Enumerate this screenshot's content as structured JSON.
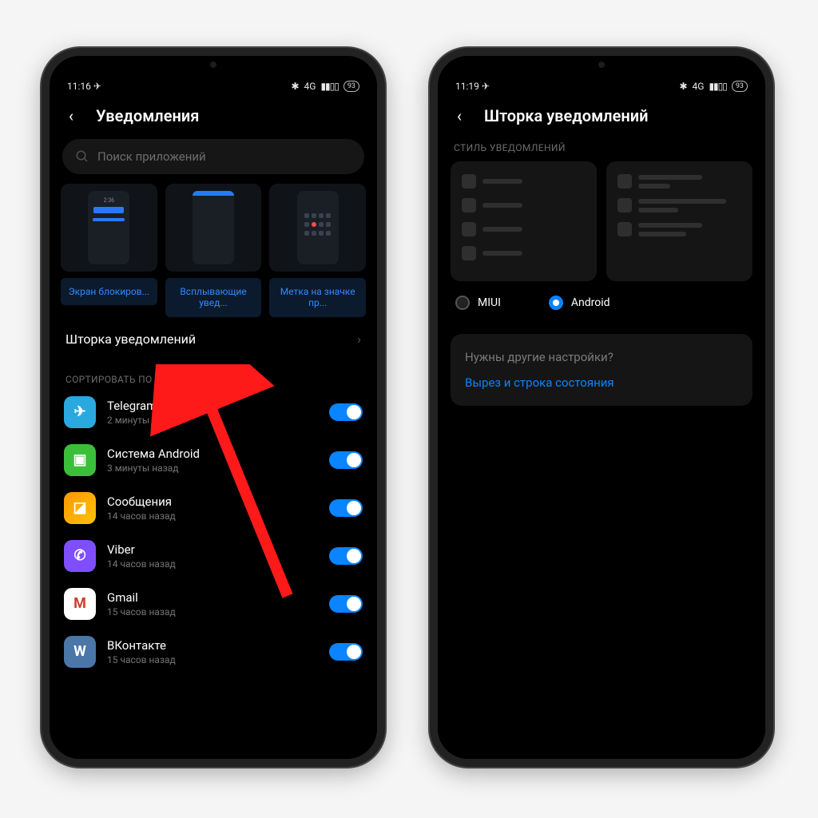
{
  "left": {
    "status": {
      "time": "11:16",
      "send": "◀",
      "battery": "93",
      "net": "4G"
    },
    "title": "Уведомления",
    "search_placeholder": "Поиск приложений",
    "tiles": [
      {
        "label": "Экран блокиров..."
      },
      {
        "label": "Всплывающие увед..."
      },
      {
        "label": "Метка на значке пр..."
      }
    ],
    "row_link": "Шторка уведомлений",
    "sort_label": "СОРТИРОВАТЬ ПО ВРЕМЕНИ",
    "apps": [
      {
        "name": "Telegram",
        "sub": "2 минуты назад",
        "icon": "telegram",
        "on": true
      },
      {
        "name": "Система Android",
        "sub": "3 минуты назад",
        "icon": "android",
        "on": true
      },
      {
        "name": "Сообщения",
        "sub": "14 часов назад",
        "icon": "msg",
        "on": true
      },
      {
        "name": "Viber",
        "sub": "14 часов назад",
        "icon": "viber",
        "on": true
      },
      {
        "name": "Gmail",
        "sub": "15 часов назад",
        "icon": "gmail",
        "on": true
      },
      {
        "name": "ВКонтакте",
        "sub": "15 часов назад",
        "icon": "vk",
        "on": true
      }
    ]
  },
  "right": {
    "status": {
      "time": "11:19",
      "send": "◀",
      "battery": "93",
      "net": "4G"
    },
    "title": "Шторка уведомлений",
    "style_label": "СТИЛЬ УВЕДОМЛЕНИЙ",
    "radio_miui": "MIUI",
    "radio_android": "Android",
    "card_question": "Нужны другие настройки?",
    "card_link": "Вырез и строка состояния"
  },
  "icons": {
    "search": "search",
    "back": "‹",
    "chevron": "›",
    "chevdown": "⌄"
  }
}
